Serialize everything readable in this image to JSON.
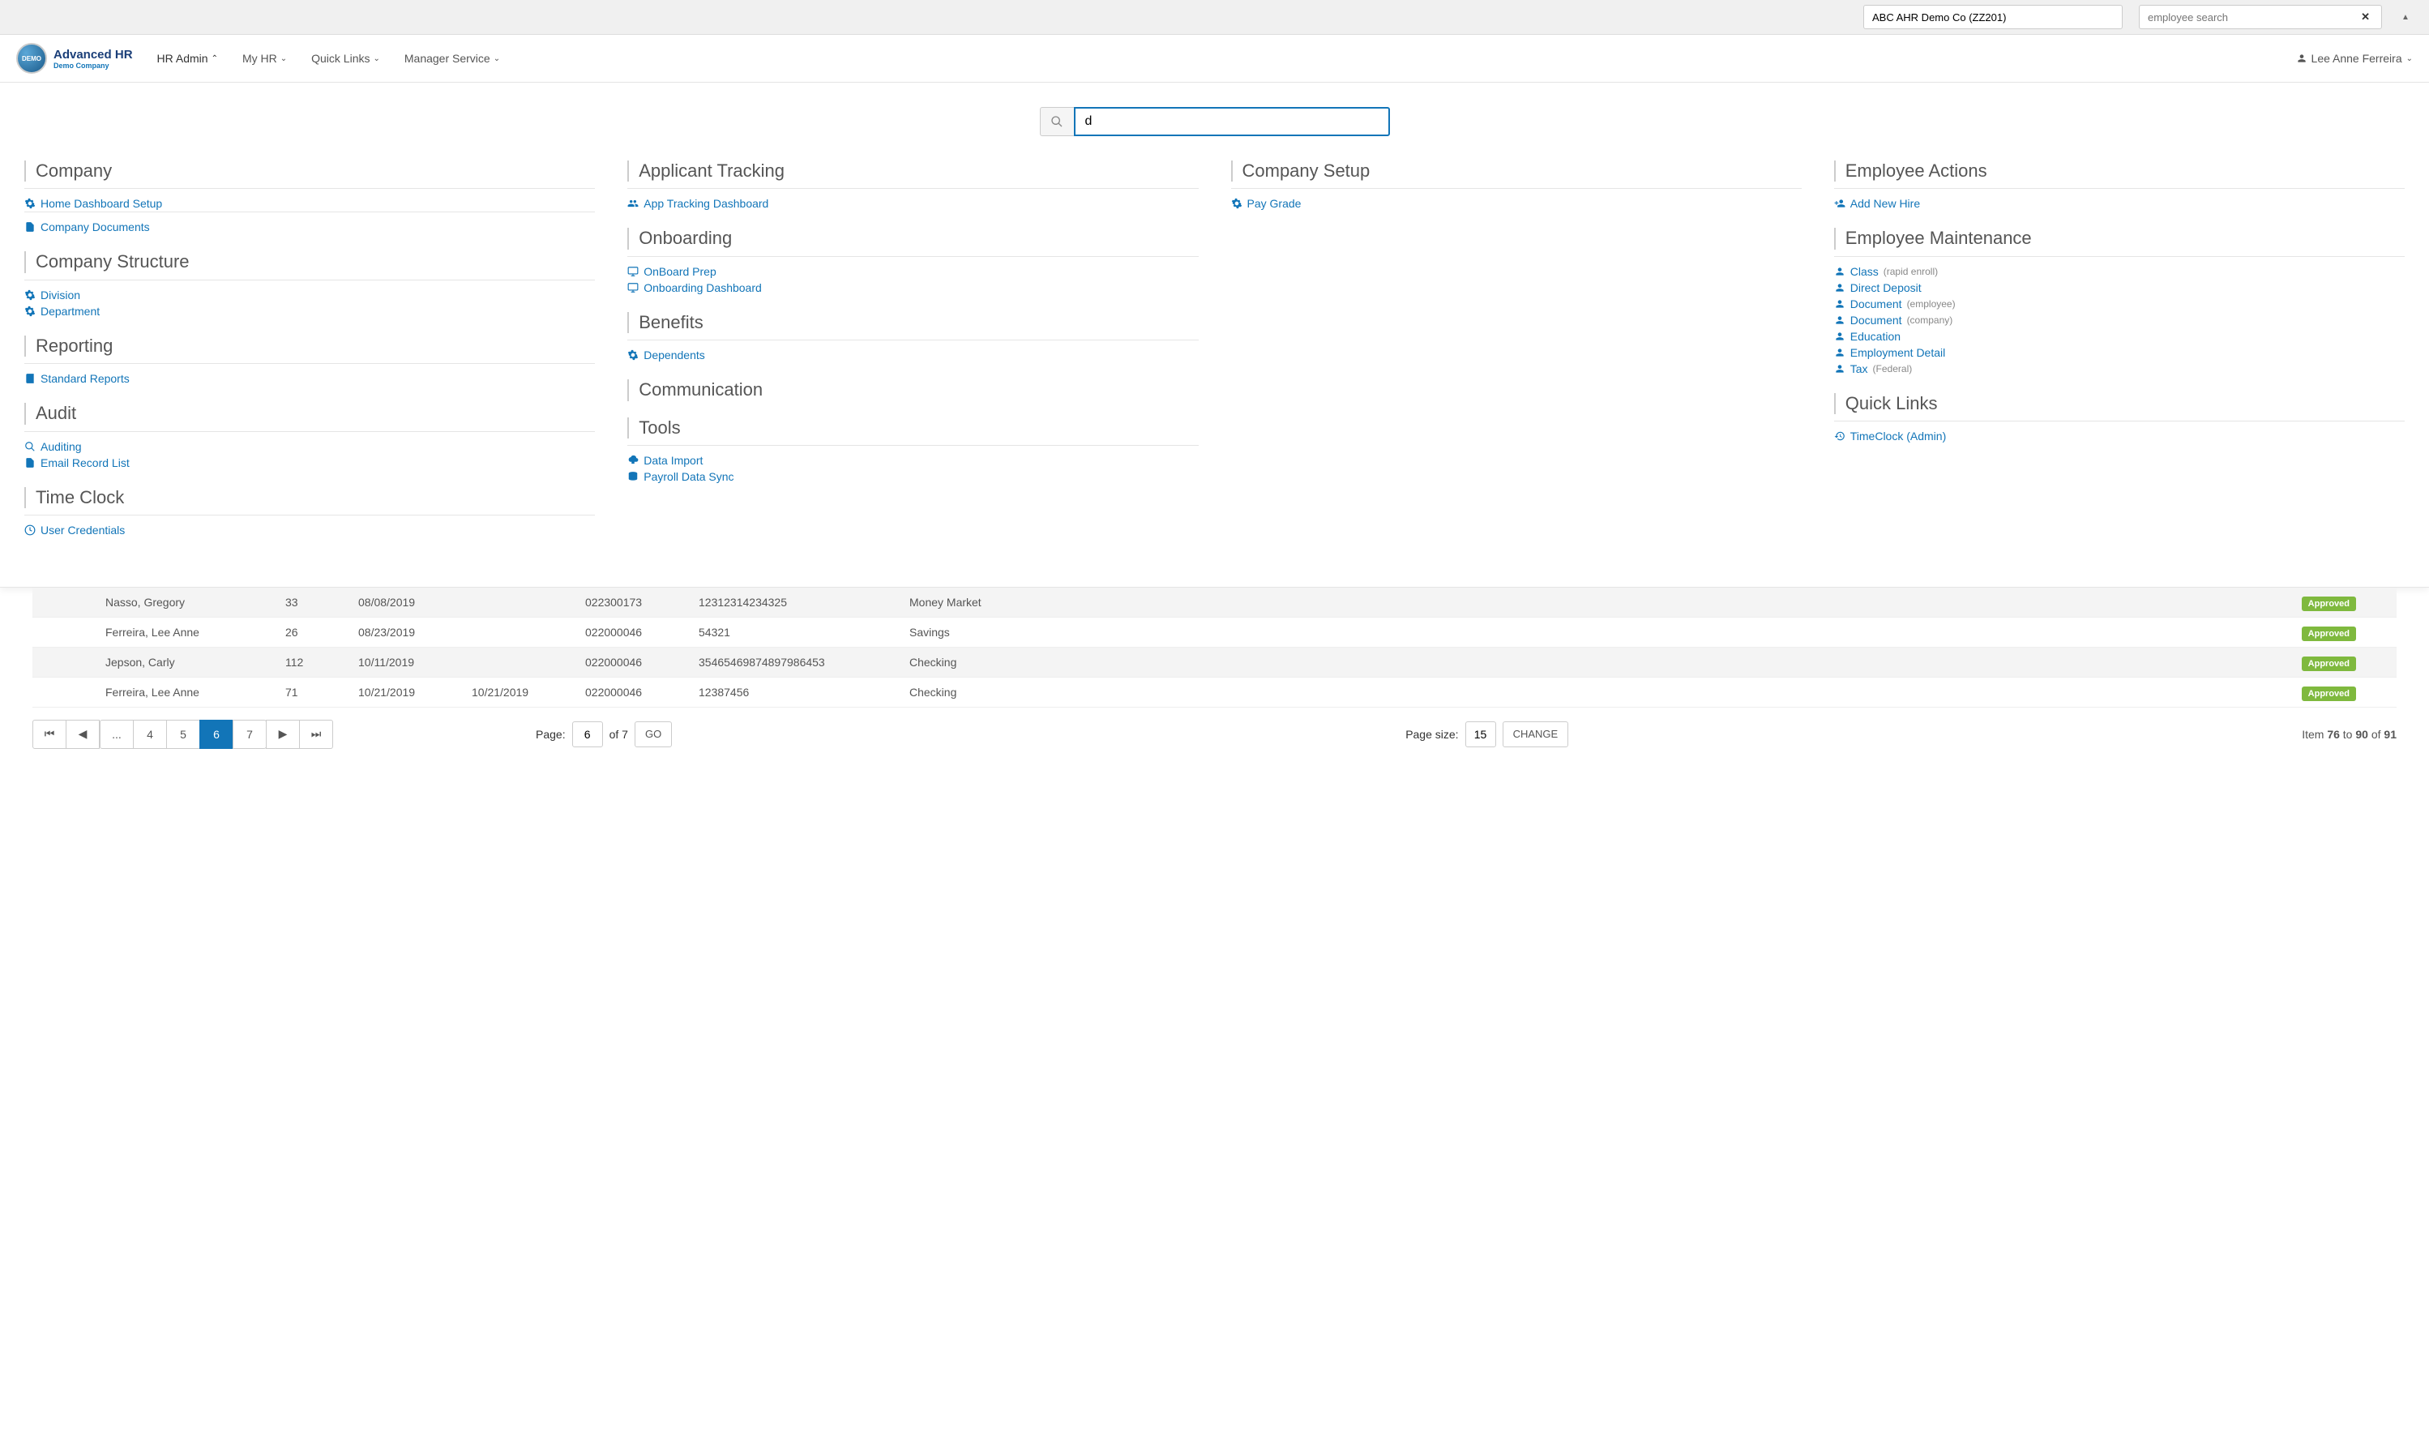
{
  "topbar": {
    "company": "ABC AHR Demo Co (ZZ201)",
    "searchPlaceholder": "employee search"
  },
  "branding": {
    "title": "Advanced HR",
    "subtitle": "Demo Company",
    "logoText": "DEMO"
  },
  "nav": {
    "hrAdmin": "HR Admin",
    "myHr": "My HR",
    "quickLinks": "Quick Links",
    "managerService": "Manager Service"
  },
  "user": {
    "name": "Lee Anne Ferreira"
  },
  "megaSearch": {
    "value": "d"
  },
  "mega": {
    "col1": {
      "company": {
        "heading": "Company",
        "homeDashboard": "Home Dashboard Setup",
        "documents": "Company Documents"
      },
      "structure": {
        "heading": "Company Structure",
        "division": "Division",
        "department": "Department"
      },
      "reporting": {
        "heading": "Reporting",
        "standardReports": "Standard Reports"
      },
      "audit": {
        "heading": "Audit",
        "auditing": "Auditing",
        "emailRecord": "Email Record List"
      },
      "timeclock": {
        "heading": "Time Clock",
        "userCred": "User Credentials"
      }
    },
    "col2": {
      "applicant": {
        "heading": "Applicant Tracking",
        "dashboard": "App Tracking Dashboard"
      },
      "onboarding": {
        "heading": "Onboarding",
        "prep": "OnBoard Prep",
        "dashboard": "Onboarding Dashboard"
      },
      "benefits": {
        "heading": "Benefits",
        "dependents": "Dependents"
      },
      "communication": {
        "heading": "Communication"
      },
      "tools": {
        "heading": "Tools",
        "dataImport": "Data Import",
        "payrollSync": "Payroll Data Sync"
      }
    },
    "col3": {
      "setup": {
        "heading": "Company Setup",
        "payGrade": "Pay Grade"
      }
    },
    "col4": {
      "actions": {
        "heading": "Employee Actions",
        "addHire": "Add New Hire"
      },
      "maintenance": {
        "heading": "Employee Maintenance",
        "class": "Class",
        "classNote": "(rapid enroll)",
        "directDeposit": "Direct Deposit",
        "document": "Document",
        "docEmpNote": "(employee)",
        "docCompNote": "(company)",
        "education": "Education",
        "employmentDetail": "Employment Detail",
        "tax": "Tax",
        "taxNote": "(Federal)"
      },
      "quicklinks": {
        "heading": "Quick Links",
        "timeclockAdmin": "TimeClock (Admin)"
      }
    }
  },
  "table": {
    "rows": [
      {
        "name": "Nasso, Gregory",
        "id": "33",
        "date1": "08/08/2019",
        "date2": "",
        "routing": "022300173",
        "account": "12312314234325",
        "type": "Money Market",
        "status": "Approved"
      },
      {
        "name": "Ferreira, Lee Anne",
        "id": "26",
        "date1": "08/23/2019",
        "date2": "",
        "routing": "022000046",
        "account": "54321",
        "type": "Savings",
        "status": "Approved"
      },
      {
        "name": "Jepson, Carly",
        "id": "112",
        "date1": "10/11/2019",
        "date2": "",
        "routing": "022000046",
        "account": "35465469874897986453",
        "type": "Checking",
        "status": "Approved"
      },
      {
        "name": "Ferreira, Lee Anne",
        "id": "71",
        "date1": "10/21/2019",
        "date2": "10/21/2019",
        "routing": "022000046",
        "account": "12387456",
        "type": "Checking",
        "status": "Approved"
      }
    ]
  },
  "pagination": {
    "pages": [
      "...",
      "4",
      "5",
      "6",
      "7"
    ],
    "activePage": "6",
    "pageLabel": "Page:",
    "pageValue": "6",
    "ofLabel": "of 7",
    "goLabel": "GO",
    "sizeLabel": "Page size:",
    "sizeValue": "15",
    "changeLabel": "CHANGE",
    "itemText1": "Item ",
    "itemFrom": "76",
    "itemText2": " to ",
    "itemTo": "90",
    "itemText3": " of ",
    "itemTotal": "91"
  }
}
